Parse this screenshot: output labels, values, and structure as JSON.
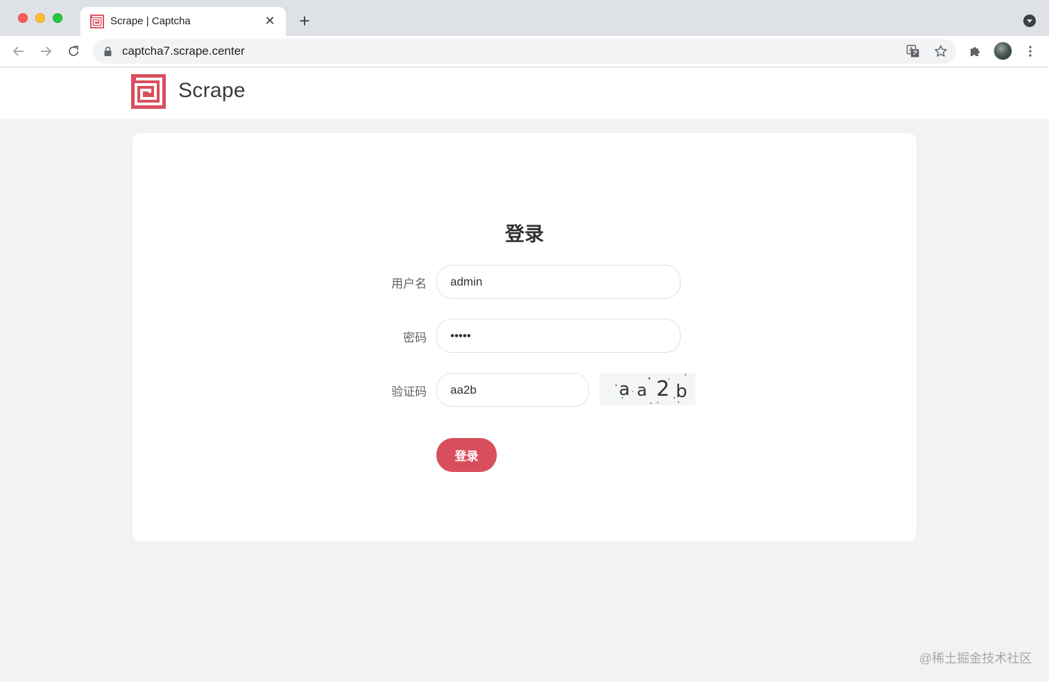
{
  "browser": {
    "tab_title": "Scrape | Captcha",
    "tab_close": "✕",
    "new_tab": "+",
    "url": "captcha7.scrape.center"
  },
  "site": {
    "brand": "Scrape",
    "brand_color": "#d94e5d"
  },
  "login_form": {
    "title": "登录",
    "username_label": "用户名",
    "username_value": "admin",
    "password_label": "密码",
    "password_value": "admin",
    "captcha_label": "验证码",
    "captcha_value": "aa2b",
    "captcha_image_text": [
      "a",
      "a",
      "2",
      "b"
    ],
    "submit_label": "登录"
  },
  "watermark": "@稀土掘金技术社区"
}
